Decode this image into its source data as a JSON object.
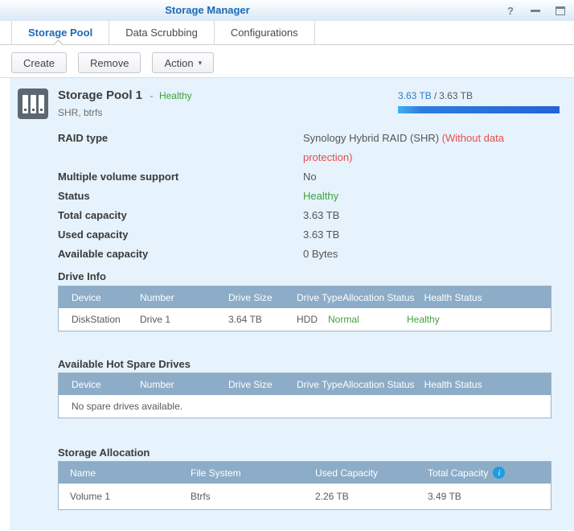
{
  "window": {
    "title": "Storage Manager",
    "controls": {
      "help": "?"
    }
  },
  "tabs": [
    {
      "label": "Storage Pool",
      "active": true
    },
    {
      "label": "Data Scrubbing",
      "active": false
    },
    {
      "label": "Configurations",
      "active": false
    }
  ],
  "toolbar": {
    "create_label": "Create",
    "remove_label": "Remove",
    "action_label": "Action",
    "action_caret": "▾"
  },
  "pool": {
    "name": "Storage Pool 1",
    "status_sep": "-",
    "status": "Healthy",
    "subtitle": "SHR, btrfs",
    "used": "3.63 TB",
    "sep": "/",
    "total": "3.63 TB",
    "bar_percent": 100
  },
  "details": {
    "rows": [
      {
        "label": "RAID type",
        "value": "Synology Hybrid RAID (SHR)",
        "value_warn": "(Without data protection)"
      },
      {
        "label": "Multiple volume support",
        "value": "No"
      },
      {
        "label": "Status",
        "value": "Healthy"
      },
      {
        "label": "Total capacity",
        "value": "3.63 TB"
      },
      {
        "label": "Used capacity",
        "value": "3.63 TB"
      },
      {
        "label": "Available capacity",
        "value": "0 Bytes"
      }
    ]
  },
  "drive_info": {
    "title": "Drive Info",
    "headers": [
      "Device",
      "Number",
      "Drive Size",
      "Drive Type",
      "Allocation Status",
      "Health Status"
    ],
    "rows": [
      [
        "DiskStation",
        "Drive 1",
        "3.64 TB",
        "HDD",
        "Normal",
        "Healthy"
      ]
    ]
  },
  "hot_spare": {
    "title": "Available Hot Spare Drives",
    "headers": [
      "Device",
      "Number",
      "Drive Size",
      "Drive Type",
      "Allocation Status",
      "Health Status"
    ],
    "empty_message": "No spare drives available."
  },
  "allocation": {
    "title": "Storage Allocation",
    "headers": [
      "Name",
      "File System",
      "Used Capacity",
      "Total Capacity"
    ],
    "info_glyph": "i",
    "rows": [
      [
        "Volume 1",
        "Btrfs",
        "2.26 TB",
        "3.49 TB"
      ]
    ]
  },
  "colors": {
    "accent_blue": "#1c6ab5",
    "value_blue": "#2e7bc0",
    "status_green": "#3fa23c",
    "warn_red": "#e25050",
    "table_header": "#8cacc7",
    "content_bg": "#e6f2fc",
    "bar_blue": "#2c7ee0"
  }
}
